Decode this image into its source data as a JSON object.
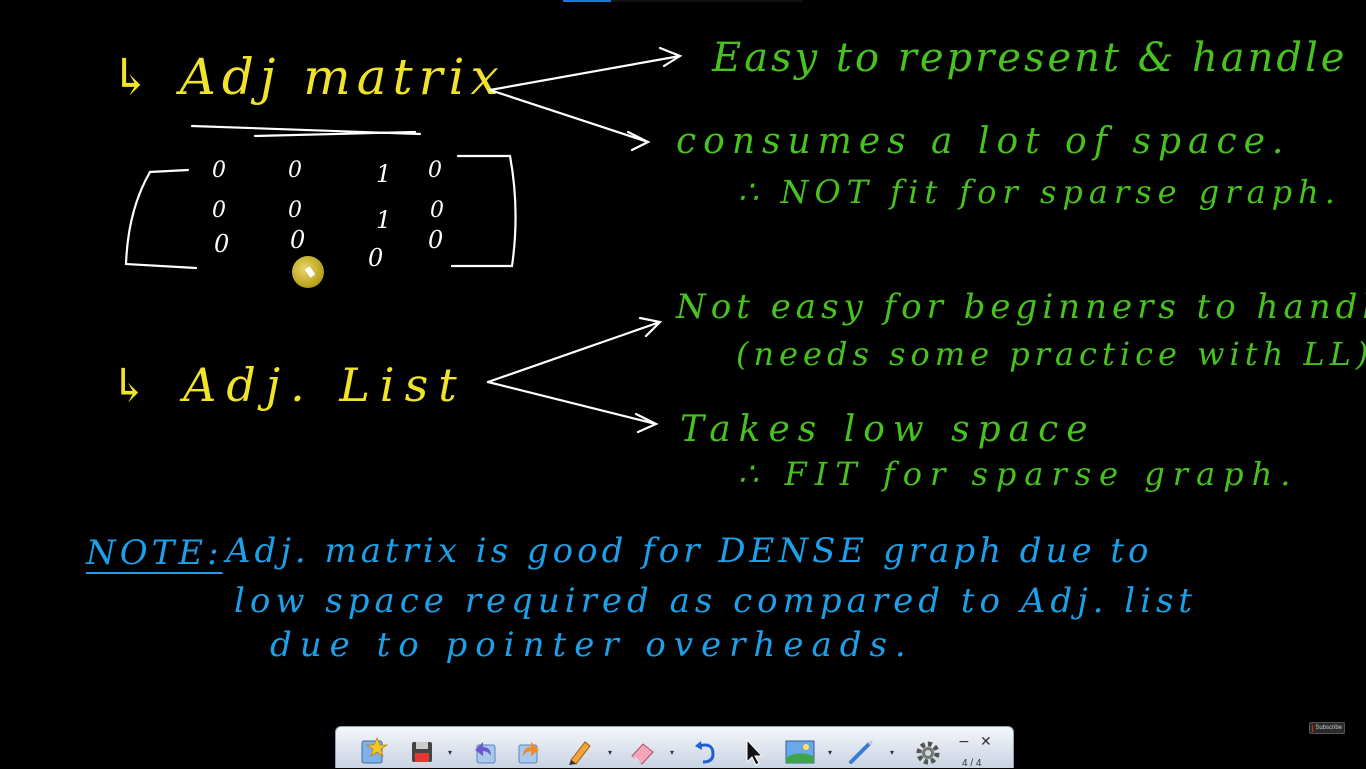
{
  "whiteboard": {
    "adj_matrix_label": "↳ Adj matrix",
    "matrix_rows": [
      [
        "0",
        "0",
        "1",
        "0"
      ],
      [
        "0",
        "0",
        "1",
        "0"
      ],
      [
        "0",
        "0",
        "0",
        "0"
      ]
    ],
    "adj_list_label": "↳ Adj. List",
    "matrix_pros": "Easy to represent & handle",
    "matrix_cons_1": "consumes a lot of space.",
    "matrix_cons_2": "∴ NOT fit for sparse graph.",
    "list_cons_1": "Not easy for beginners to handle",
    "list_cons_2": "(needs some practice with LL)",
    "list_pros_1": "Takes low space",
    "list_pros_2": "∴ FIT for sparse graph.",
    "note_label": "NOTE:",
    "note_line_1": "Adj. matrix is good for DENSE graph due to",
    "note_line_2": "low space required as compared to Adj. list",
    "note_line_3": "due to pointer overheads."
  },
  "colors": {
    "yellow_ink": "#f1e32a",
    "green_ink": "#48c21f",
    "blue_ink": "#1da0ea",
    "white_ink": "#ffffff"
  },
  "subscribe_badge": {
    "icon": "youtube-icon",
    "text": "Subscribe"
  },
  "toolbar": {
    "buttons": [
      "star-pen-icon",
      "save-icon",
      "undo-icon",
      "redo-icon",
      "pen-icon",
      "eraser-icon",
      "undo-arrow-icon",
      "cursor-arrow-icon",
      "image-icon",
      "pointer-wand-icon",
      "settings-icon"
    ],
    "minimize": "−",
    "close": "✕",
    "page_indicator": "4 / 4"
  }
}
